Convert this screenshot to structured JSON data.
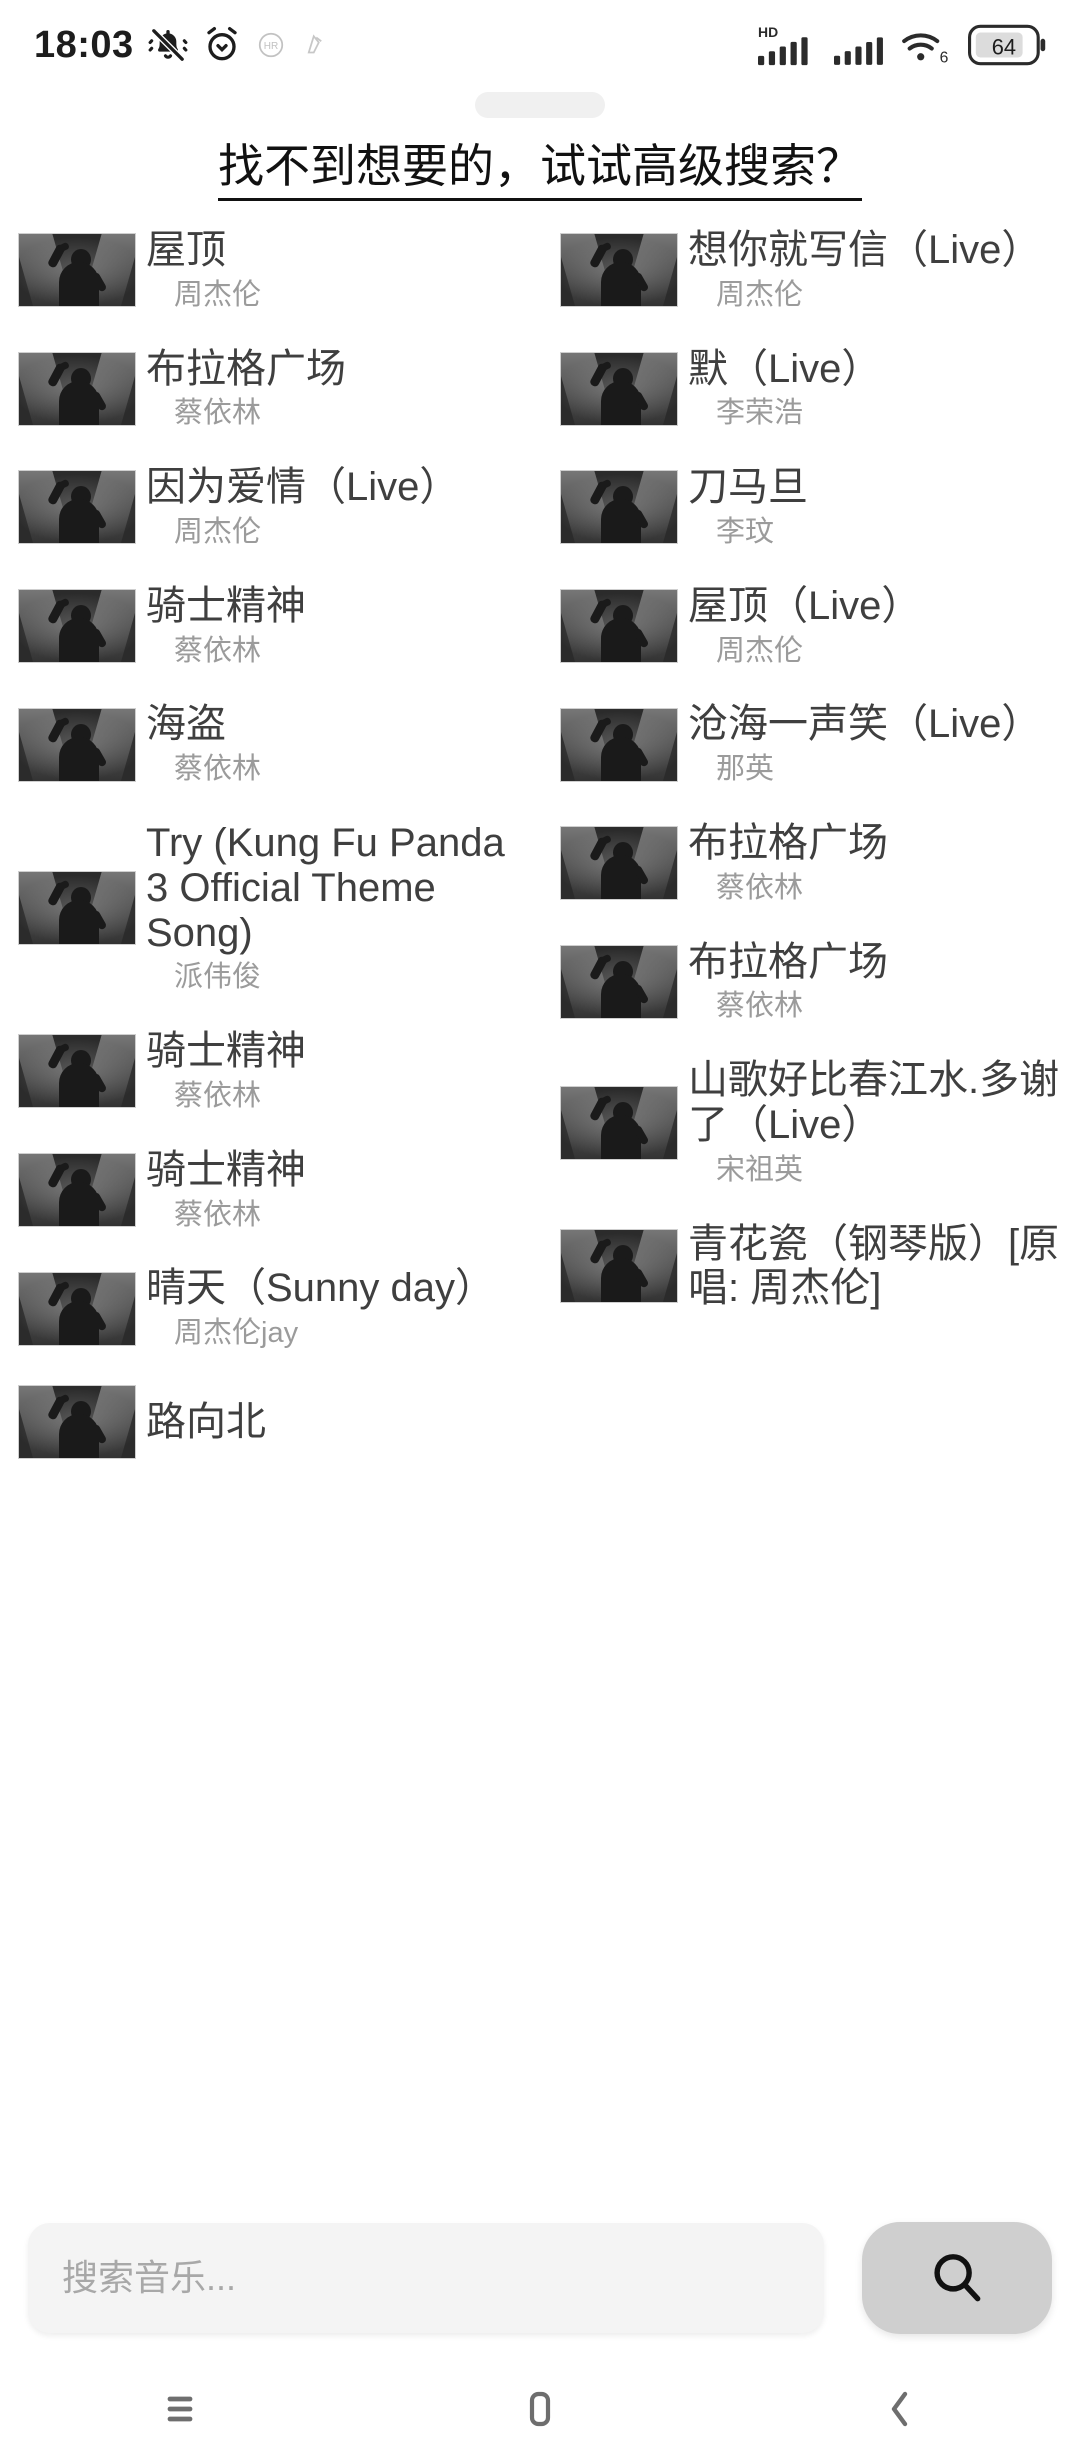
{
  "status_bar": {
    "time": "18:03",
    "icons_left": [
      "mute-bell-icon",
      "alarm-clock-icon",
      "hi-res-audio-icon",
      "app-badge-icon"
    ],
    "network_label": "HD",
    "wifi_label": "6",
    "battery_level": "64",
    "icons_right": [
      "hd-signal-icon",
      "signal-bars-icon",
      "wifi-6-icon",
      "battery-icon"
    ]
  },
  "header": {
    "advanced_search_link": "找不到想要的，试试高级搜索？"
  },
  "results": {
    "left_column": [
      {
        "title": "屋顶",
        "artist": "周杰伦"
      },
      {
        "title": "布拉格广场",
        "artist": "蔡依林"
      },
      {
        "title": "因为爱情（Live）",
        "artist": "周杰伦"
      },
      {
        "title": "骑士精神",
        "artist": "蔡依林"
      },
      {
        "title": "海盗",
        "artist": "蔡依林"
      },
      {
        "title": "Try (Kung Fu Panda 3 Official Theme Song)",
        "artist": "派伟俊"
      },
      {
        "title": "骑士精神",
        "artist": "蔡依林"
      },
      {
        "title": "骑士精神",
        "artist": "蔡依林"
      },
      {
        "title": "晴天（Sunny day）",
        "artist": "周杰伦jay"
      },
      {
        "title": "路向北",
        "artist": ""
      }
    ],
    "right_column": [
      {
        "title": "想你就写信（Live）",
        "artist": "周杰伦"
      },
      {
        "title": "默（Live）",
        "artist": "李荣浩"
      },
      {
        "title": "刀马旦",
        "artist": "李玟"
      },
      {
        "title": "屋顶（Live）",
        "artist": "周杰伦"
      },
      {
        "title": "沧海一声笑（Live）",
        "artist": "那英"
      },
      {
        "title": "布拉格广场",
        "artist": "蔡依林"
      },
      {
        "title": "布拉格广场",
        "artist": "蔡依林"
      },
      {
        "title": "山歌好比春江水.多谢了（Live）",
        "artist": "宋祖英"
      },
      {
        "title": "青花瓷（钢琴版）[原唱: 周杰伦]",
        "artist": ""
      }
    ]
  },
  "search": {
    "value": "",
    "placeholder": "搜索音乐...",
    "button_icon": "search-icon"
  },
  "nav_bar": {
    "recents_icon": "menu-recents-icon",
    "home_icon": "home-icon",
    "back_icon": "back-chevron-icon"
  },
  "colors": {
    "background": "#ffffff",
    "title_text": "#3f3f3f",
    "artist_text": "#9b9b9b",
    "link_text": "#111111",
    "input_bg": "#f4f4f4",
    "button_bg": "#cfcfcf"
  }
}
